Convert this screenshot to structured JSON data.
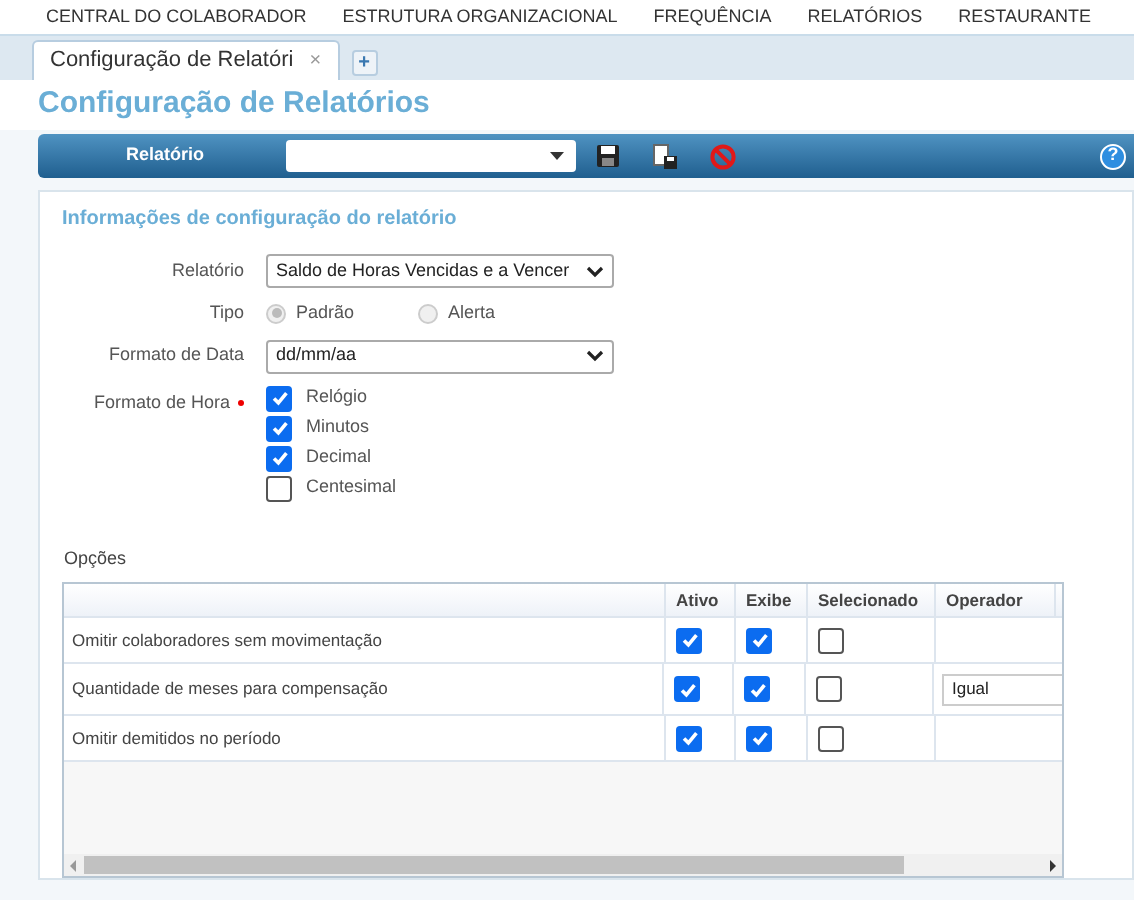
{
  "top_menu": [
    "CENTRAL DO COLABORADOR",
    "ESTRUTURA ORGANIZACIONAL",
    "FREQUÊNCIA",
    "RELATÓRIOS",
    "RESTAURANTE"
  ],
  "tabs": [
    {
      "label": "Configuração de Relatóri",
      "selected": true,
      "close": "×"
    }
  ],
  "add_tab": "+",
  "page_title": "Configuração de Relatórios",
  "toolbar": {
    "label": "Relatório",
    "help": "?"
  },
  "section_title": "Informações de configuração do relatório",
  "form": {
    "relatorio_label": "Relatório",
    "relatorio_value": "Saldo de Horas Vencidas e a Vencer",
    "tipo_label": "Tipo",
    "tipo_options": [
      {
        "label": "Padrão",
        "selected": true
      },
      {
        "label": "Alerta",
        "selected": false
      }
    ],
    "data_label": "Formato de Data",
    "data_value": "dd/mm/aa",
    "hora_label": "Formato de Hora",
    "hora_required": true,
    "hora_options": [
      {
        "label": "Relógio",
        "checked": true
      },
      {
        "label": "Minutos",
        "checked": true
      },
      {
        "label": "Decimal",
        "checked": true
      },
      {
        "label": "Centesimal",
        "checked": false
      }
    ]
  },
  "options_title": "Opções",
  "table": {
    "columns": [
      "Ativo",
      "Exibe",
      "Selecionado",
      "Operador"
    ],
    "rows": [
      {
        "label": "Omitir colaboradores sem movimentação",
        "ativo": true,
        "exibe": true,
        "selecionado": false
      },
      {
        "label": "Quantidade de meses para compensação",
        "ativo": true,
        "exibe": true,
        "selecionado": false,
        "operador": "Igual"
      },
      {
        "label": "Omitir demitidos no período",
        "ativo": true,
        "exibe": true,
        "selecionado": false
      }
    ]
  }
}
